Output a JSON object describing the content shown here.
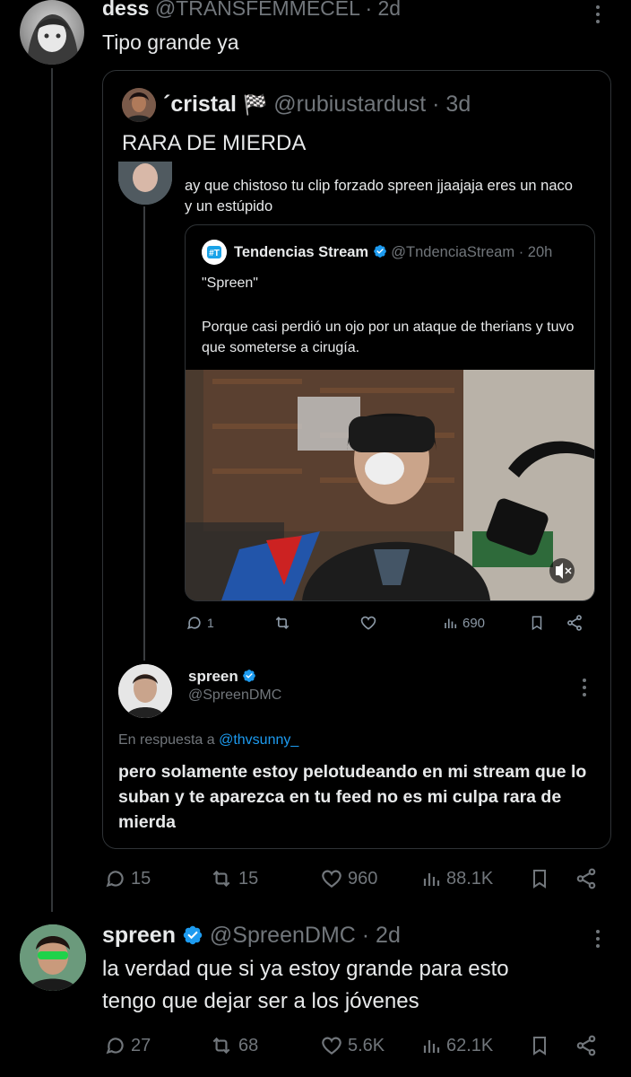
{
  "tweet1": {
    "display_name": "dess",
    "handle": "@TRANSFEMMECEL",
    "time": "· 2d",
    "text": "Tipo grande ya"
  },
  "quote": {
    "display_name": "´cristal",
    "flag_emoji": "🏁",
    "handle": "@rubiustardust",
    "time": "· 3d",
    "text": "RARA DE MIERDA",
    "screenshot": {
      "reply_text": "ay que chistoso tu clip forzado spreen jjaajaja eres un naco y un estúpido",
      "inner_tweet": {
        "display_name": "Tendencias Stream",
        "handle": "@TndenciaStream",
        "time": "· 20h",
        "line1": "\"Spreen\"",
        "line2": "Porque casi perdió un ojo por un ataque de therians y tuvo que someterse a cirugía.",
        "image_alt": "Streamer with eye patch and star wars beanie in front of shelves",
        "replies": "1",
        "views": "690"
      },
      "reply_tweet": {
        "display_name": "spreen",
        "handle": "@SpreenDMC",
        "reply_prefix": "En respuesta a",
        "reply_to": "@thvsunny_",
        "text": "pero solamente estoy pelotudeando en mi stream que lo suban y te aparezca en tu feed no es mi culpa rara de mierda"
      }
    }
  },
  "tweet1_actions": {
    "replies": "15",
    "retweets": "15",
    "likes": "960",
    "views": "88.1K"
  },
  "tweet2": {
    "display_name": "spreen",
    "handle": "@SpreenDMC",
    "time": "· 2d",
    "text_line1": "la verdad que si ya estoy grande para esto",
    "text_line2": "tengo que dejar ser a los jóvenes",
    "replies": "27",
    "retweets": "68",
    "likes": "5.6K",
    "views": "62.1K"
  },
  "colors": {
    "background": "#000000",
    "text": "#e7e9ea",
    "muted": "#71767b",
    "border": "#2f3336",
    "verified": "#1d9bf0"
  }
}
